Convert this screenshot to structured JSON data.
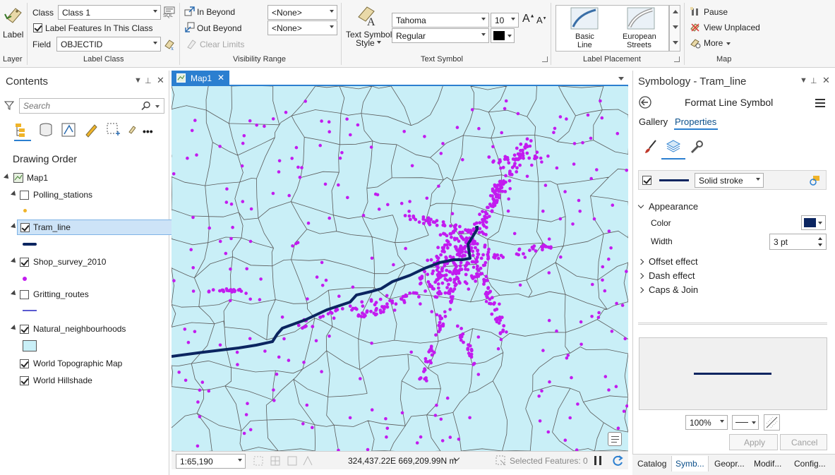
{
  "ribbon": {
    "layer_group": {
      "label_button": "Label",
      "group_label": "Layer"
    },
    "label_class_group": {
      "class_label": "Class",
      "class_value": "Class 1",
      "sql_label": "SQL",
      "label_features_text": "Label Features In This Class",
      "label_features_checked": true,
      "field_label": "Field",
      "field_value": "OBJECTID",
      "group_label": "Label Class"
    },
    "visibility_group": {
      "in_beyond": "In Beyond",
      "out_beyond": "Out Beyond",
      "clear_limits": "Clear Limits",
      "in_beyond_value": "<None>",
      "out_beyond_value": "<None>",
      "group_label": "Visibility Range"
    },
    "text_symbol_group": {
      "text_symbol_style_line1": "Text Symbol",
      "text_symbol_style_line2": "Style",
      "font_value": "Tahoma",
      "size_value": "10",
      "style_value": "Regular",
      "grow_font_glyph": "A",
      "shrink_font_glyph": "A",
      "text_color": "#000000",
      "group_label": "Text Symbol"
    },
    "placement_group": {
      "basic_line_1": "Basic",
      "basic_line_2": "Line",
      "european_1": "European",
      "european_2": "Streets",
      "group_label": "Label Placement"
    },
    "map_group": {
      "pause": "Pause",
      "view_unplaced": "View Unplaced",
      "more": "More",
      "group_label": "Map"
    }
  },
  "contents": {
    "title": "Contents",
    "search_placeholder": "Search",
    "section_title": "Drawing Order",
    "map_name": "Map1",
    "layers": [
      {
        "name": "Polling_stations",
        "checked": false,
        "selected": false
      },
      {
        "name": "Tram_line",
        "checked": true,
        "selected": true
      },
      {
        "name": "Shop_survey_2010",
        "checked": true,
        "selected": false
      },
      {
        "name": "Gritting_routes",
        "checked": false,
        "selected": false
      },
      {
        "name": "Natural_neighbourhoods",
        "checked": true,
        "selected": false
      },
      {
        "name": "World Topographic Map",
        "checked": true,
        "selected": false
      },
      {
        "name": "World Hillshade",
        "checked": true,
        "selected": false
      }
    ]
  },
  "map": {
    "tab_name": "Map1",
    "scale": "1:65,190",
    "coordinates": "324,437.22E 669,209.99N m",
    "selected_features": "Selected Features: 0",
    "colors": {
      "background": "#c9eff7",
      "boundaries": "#5a5a5a",
      "shops": "#c21bef",
      "tram": "#0b2560"
    }
  },
  "symbology": {
    "title": "Symbology - Tram_line",
    "subtitle": "Format Line Symbol",
    "tabs": [
      "Gallery",
      "Properties"
    ],
    "active_tab": "Properties",
    "layer_type": "Solid stroke",
    "sections": {
      "appearance": "Appearance",
      "offset": "Offset effect",
      "dash": "Dash effect",
      "caps": "Caps & Join"
    },
    "color_label": "Color",
    "color_value": "#0b2560",
    "width_label": "Width",
    "width_value": "3 pt",
    "zoom_value": "100%",
    "apply_button": "Apply",
    "cancel_button": "Cancel"
  },
  "bottom_tabs": [
    "Catalog",
    "Symb...",
    "Geopr...",
    "Modif...",
    "Config..."
  ],
  "active_bottom_tab": "Symb..."
}
